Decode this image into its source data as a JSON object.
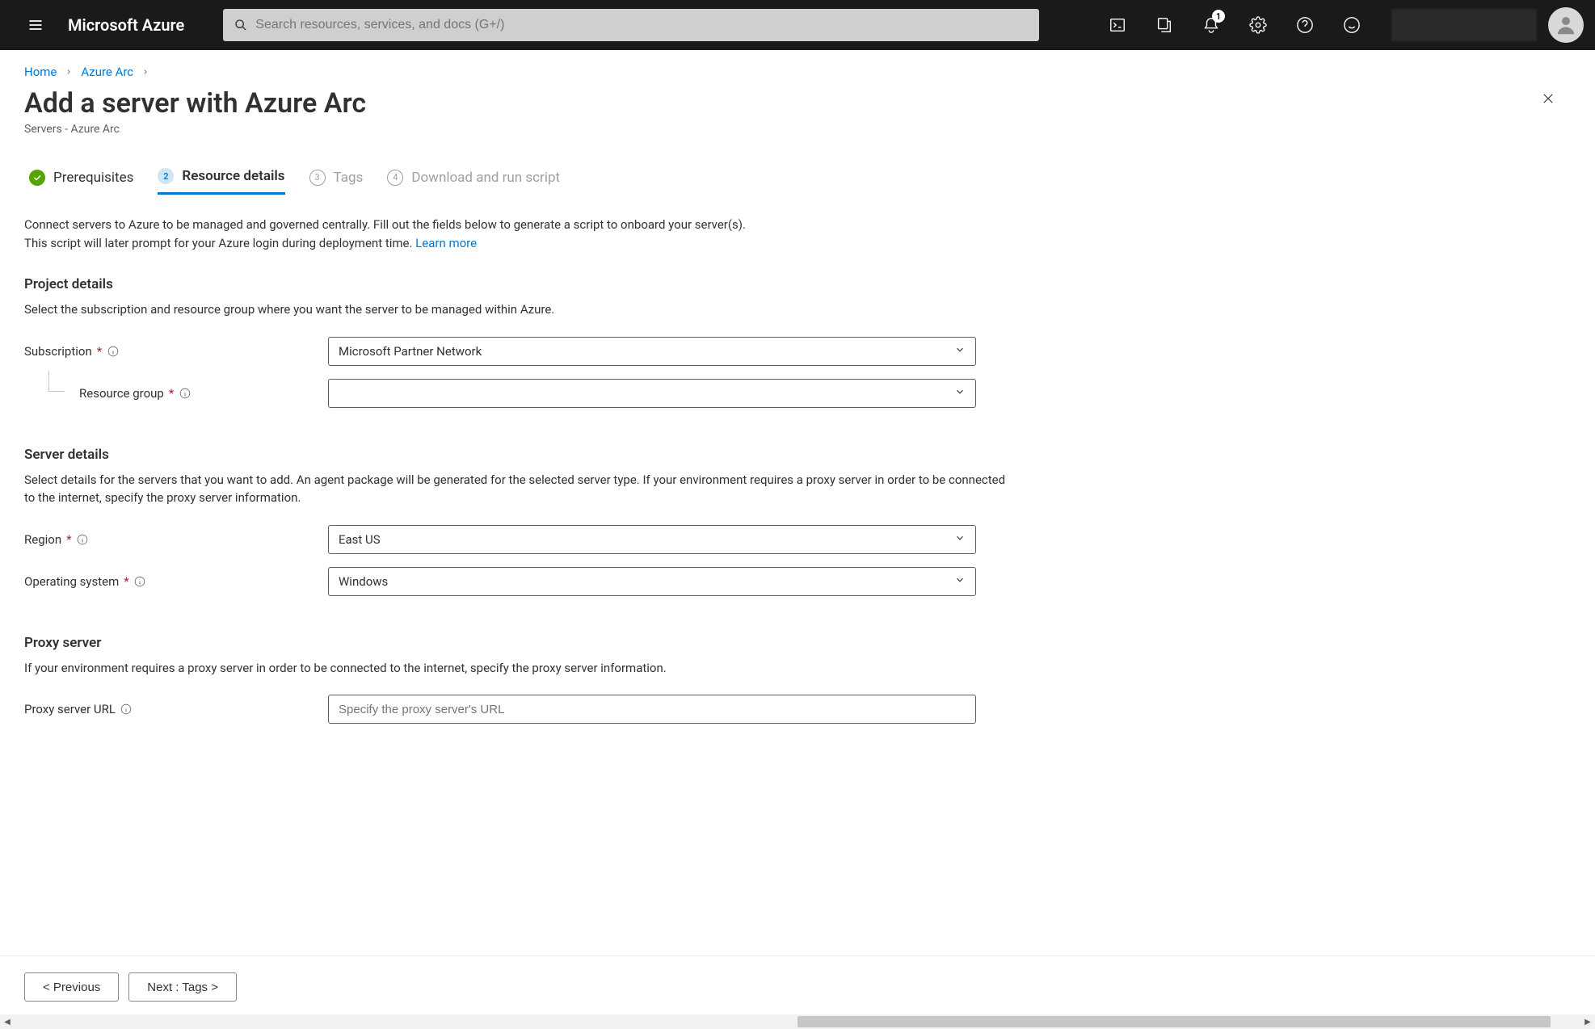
{
  "brand": "Microsoft Azure",
  "search": {
    "placeholder": "Search resources, services, and docs (G+/)"
  },
  "notifications": {
    "count": "1"
  },
  "breadcrumb": {
    "home": "Home",
    "arc": "Azure Arc"
  },
  "page": {
    "title": "Add a server with Azure Arc",
    "subtitle": "Servers - Azure Arc"
  },
  "steps": {
    "s1": "Prerequisites",
    "s2": "Resource details",
    "s3": "Tags",
    "s4": "Download and run script",
    "n2": "2",
    "n3": "3",
    "n4": "4"
  },
  "intro": {
    "line1": "Connect servers to Azure to be managed and governed centrally. Fill out the fields below to generate a script to onboard your server(s).",
    "line2a": "This script will later prompt for your Azure login during deployment time. ",
    "learn": "Learn more"
  },
  "project": {
    "heading": "Project details",
    "desc": "Select the subscription and resource group where you want the server to be managed within Azure.",
    "subscription_label": "Subscription",
    "subscription_value": "Microsoft Partner Network",
    "rg_label": "Resource group",
    "rg_value": ""
  },
  "server": {
    "heading": "Server details",
    "desc": "Select details for the servers that you want to add. An agent package will be generated for the selected server type. If your environment requires a proxy server in order to be connected to the internet, specify the proxy server information.",
    "region_label": "Region",
    "region_value": "East US",
    "os_label": "Operating system",
    "os_value": "Windows"
  },
  "proxy": {
    "heading": "Proxy server",
    "desc": "If your environment requires a proxy server in order to be connected to the internet, specify the proxy server information.",
    "label": "Proxy server URL",
    "placeholder": "Specify the proxy server's URL",
    "value": ""
  },
  "footer": {
    "prev": "< Previous",
    "next": "Next : Tags >"
  }
}
